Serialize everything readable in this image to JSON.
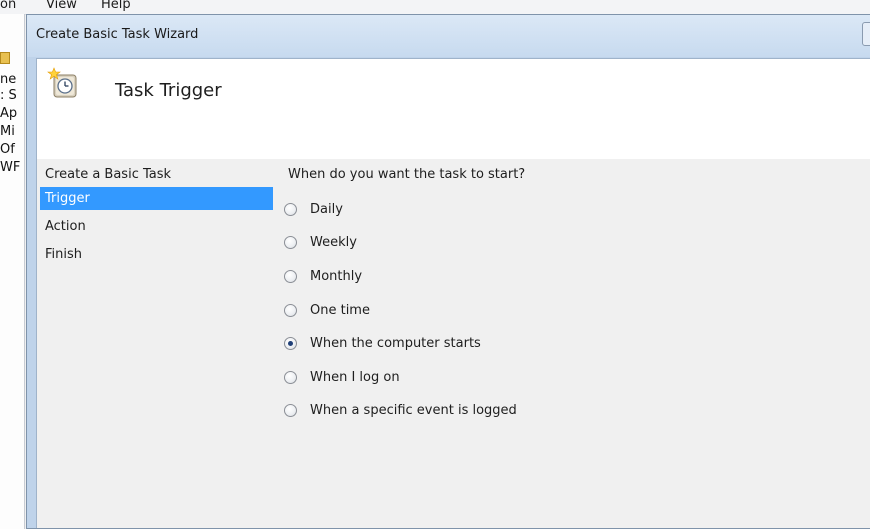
{
  "background_app": {
    "menu": [
      "on",
      "View",
      "Help"
    ],
    "side_texts": [
      "ne",
      ": S",
      "Ap",
      "Mi",
      "Of",
      "WF"
    ]
  },
  "wizard": {
    "title": "Create Basic Task Wizard",
    "header_title": "Task Trigger",
    "header_icon": "clock-task-icon",
    "nav": [
      {
        "label": "Create a Basic Task",
        "selected": false
      },
      {
        "label": "Trigger",
        "selected": true
      },
      {
        "label": "Action",
        "selected": false
      },
      {
        "label": "Finish",
        "selected": false
      }
    ],
    "question": "When do you want the task to start?",
    "options": [
      {
        "label": "Daily",
        "checked": false
      },
      {
        "label": "Weekly",
        "checked": false
      },
      {
        "label": "Monthly",
        "checked": false
      },
      {
        "label": "One time",
        "checked": false
      },
      {
        "label": "When the computer starts",
        "checked": true
      },
      {
        "label": "When I log on",
        "checked": false
      },
      {
        "label": "When a specific event is logged",
        "checked": false
      }
    ]
  },
  "colors": {
    "selection": "#3399ff",
    "titlebar": "#c7daef",
    "panel": "#f0f0f0"
  }
}
